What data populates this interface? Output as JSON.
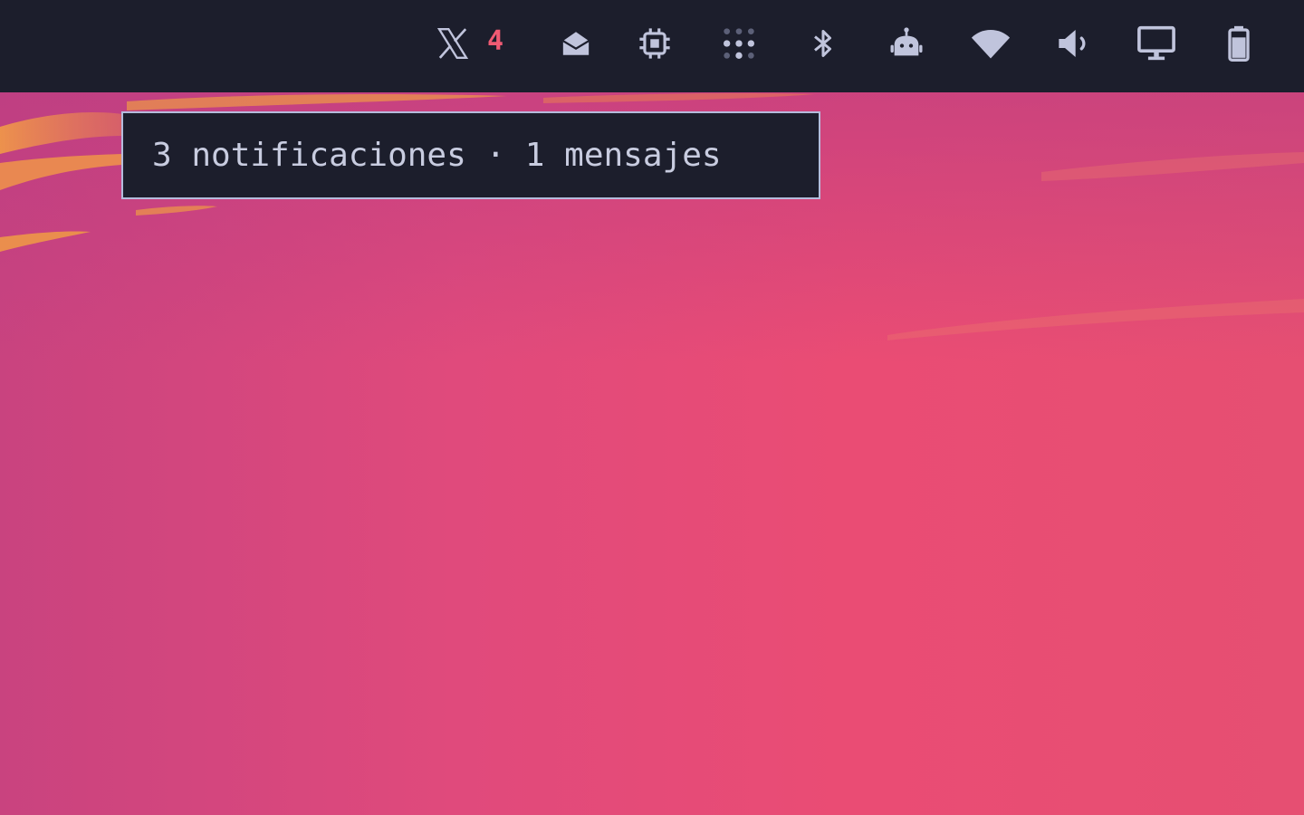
{
  "statusbar": {
    "x_app": {
      "icon": "x-logo-icon",
      "badge_count": "4",
      "badge_color": "#ef5a73"
    },
    "tray_icons": [
      {
        "name": "mail-open-icon"
      },
      {
        "name": "cpu-icon"
      },
      {
        "name": "apps-grid-icon"
      },
      {
        "name": "bluetooth-icon"
      },
      {
        "name": "robot-icon"
      },
      {
        "name": "wifi-icon"
      },
      {
        "name": "volume-icon"
      },
      {
        "name": "monitor-icon"
      },
      {
        "name": "battery-icon"
      }
    ],
    "bar_color": "#1c1e2c",
    "icon_color": "#c0c4dc"
  },
  "tooltip": {
    "text": "3 notificaciones · 1 mensajes"
  },
  "wallpaper": {
    "colors": [
      "#c9437f",
      "#e04a7c",
      "#ea4c74",
      "#f5a83c"
    ]
  }
}
